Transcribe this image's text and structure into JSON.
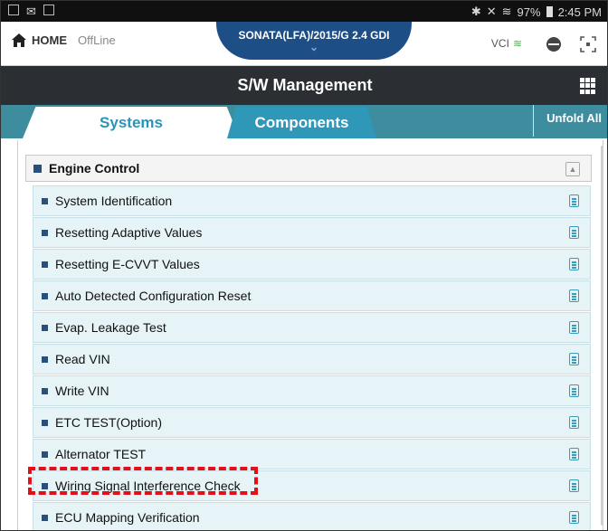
{
  "status_bar": {
    "battery": "97%",
    "time": "2:45 PM"
  },
  "topbar": {
    "home_label": "HOME",
    "offline_label": "OffLine",
    "vehicle": "SONATA(LFA)/2015/G 2.4 GDI",
    "vci_label": "VCI"
  },
  "header": {
    "title": "S/W Management"
  },
  "tabs": [
    {
      "label": "Systems",
      "active": true
    },
    {
      "label": "Components",
      "active": false
    }
  ],
  "unfold_all_label": "Unfold All",
  "group": {
    "label": "Engine Control"
  },
  "items": [
    {
      "label": "System Identification"
    },
    {
      "label": "Resetting Adaptive Values"
    },
    {
      "label": "Resetting E-CVVT Values"
    },
    {
      "label": "Auto Detected Configuration Reset"
    },
    {
      "label": "Evap. Leakage Test"
    },
    {
      "label": "Read VIN"
    },
    {
      "label": "Write VIN"
    },
    {
      "label": "ETC TEST(Option)"
    },
    {
      "label": "Alternator TEST"
    },
    {
      "label": "Wiring Signal Interference Check",
      "highlighted": true
    },
    {
      "label": "ECU Mapping Verification"
    }
  ],
  "colors": {
    "header_bg": "#2b2e33",
    "tab_bar_bg": "#3d8d9f",
    "active_tab_text": "#2a93b6",
    "row_bg": "#e6f3f7",
    "highlight": "#e3101a",
    "vehicle_bg": "#1d4f86"
  }
}
